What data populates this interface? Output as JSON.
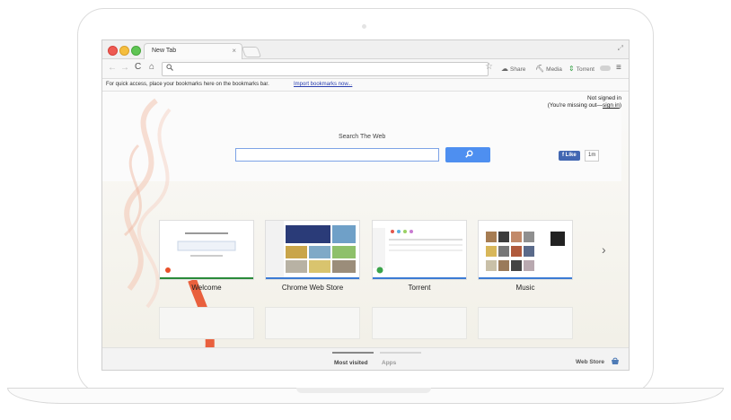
{
  "tab": {
    "title": "New Tab",
    "close": "×"
  },
  "window": {
    "restore_icon": "⤢"
  },
  "toolbar": {
    "back": "←",
    "forward": "→",
    "reload": "C",
    "home": "⌂",
    "search_icon": "🔍",
    "star": "☆",
    "extensions": [
      {
        "label": "Share",
        "icon": "☁"
      },
      {
        "label": "Media",
        "icon": "⛏"
      },
      {
        "label": "Torrent",
        "icon": "⇕"
      }
    ],
    "menu": "≡"
  },
  "bookmarks": {
    "text": "For quick access, place your bookmarks here on the bookmarks bar.",
    "link": "Import bookmarks now..."
  },
  "signin": {
    "line1": "Not signed in",
    "line2_prefix": "(You're missing out—",
    "link": "sign in",
    "line2_suffix": ")"
  },
  "search": {
    "label": "Search The Web",
    "button_icon": "⚲"
  },
  "facebook": {
    "like": "f Like",
    "count": "1m"
  },
  "tiles": [
    {
      "label": "Welcome",
      "bar_color": "#2a8a3a"
    },
    {
      "label": "Chrome Web Store",
      "bar_color": "#3b7bd4"
    },
    {
      "label": "Torrent",
      "bar_color": "#3b7bd4"
    },
    {
      "label": "Music",
      "bar_color": "#3b7bd4"
    }
  ],
  "next_arrow": "›",
  "footer": {
    "most_visited": "Most visited",
    "apps": "Apps",
    "web_store": "Web Store"
  }
}
